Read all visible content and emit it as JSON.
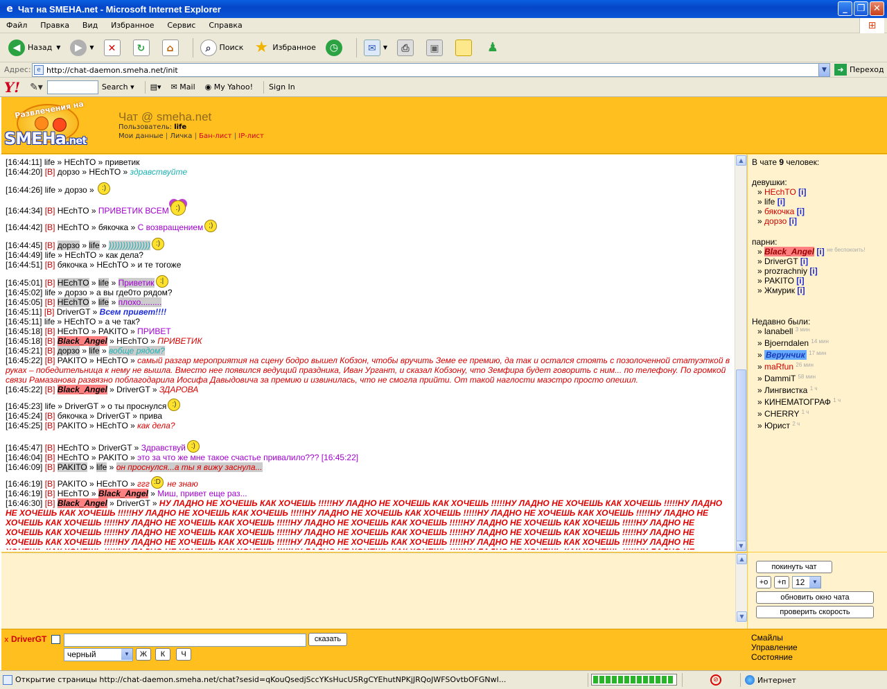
{
  "window": {
    "title": "Чат на SMEHA.net - Microsoft Internet Explorer"
  },
  "menu": [
    "Файл",
    "Правка",
    "Вид",
    "Избранное",
    "Сервис",
    "Справка"
  ],
  "toolbar": {
    "back": "Назад",
    "search": "Поиск",
    "favorites": "Избранное"
  },
  "address": {
    "label": "Адрес:",
    "url": "http://chat-daemon.smeha.net/init",
    "go": "Переход"
  },
  "yahoo": {
    "search": "Search",
    "mail": "Mail",
    "my_yahoo": "My Yahoo!",
    "sign_in": "Sign In"
  },
  "header": {
    "logo_arc": "Развлечения на",
    "logo_text": "SMEHa",
    "logo_net": ".net",
    "site_title": "Чат @ smeha.net",
    "user_label": "Пользователь:",
    "user_name": "life",
    "links": [
      "Мои данные",
      "Личка",
      "Бан-лист",
      "IP-лист"
    ]
  },
  "chat": {
    "messages": [
      {
        "ts": "[16:44:11]",
        "from": "life",
        "to": "HEchTO",
        "text": "приветик",
        "style": "plain"
      },
      {
        "ts": "[16:44:20]",
        "priv": "[В]",
        "from": "дорзо",
        "to": "HEchTO",
        "text": "здравствуйте",
        "style": "cyan"
      },
      {
        "ts": "[16:44:26]",
        "from": "life",
        "to": "дорзо",
        "text": "",
        "smiley": ":)"
      },
      {
        "ts": "[16:44:34]",
        "priv": "[В]",
        "from": "HEchTO",
        "text": "ПРИВЕТИК ВСЕМ",
        "style": "violet",
        "smiley": ":)"
      },
      {
        "ts": "[16:44:42]",
        "priv": "[В]",
        "from": "HEchTO",
        "to": "бякочка",
        "text": "С возвращением",
        "style": "violet",
        "smiley": ";)"
      },
      {
        "ts": "[16:44:45]",
        "priv": "[В]",
        "from": "дорзо",
        "to": "life",
        "text": ")))))))))))))))",
        "style": "cyan",
        "smiley": ":)"
      },
      {
        "ts": "[16:44:49]",
        "from": "life",
        "to": "HEchTO",
        "text": "как дела?",
        "style": "plain"
      },
      {
        "ts": "[16:44:51]",
        "priv": "[В]",
        "from": "бякочка",
        "to": "HEchTO",
        "text": "и те тогоже",
        "style": "plain"
      },
      {
        "ts": "[16:45:01]",
        "priv": "[В]",
        "from": "HEchTO",
        "to": "life",
        "text": "Приветик",
        "style": "violet",
        "smiley": ":|"
      },
      {
        "ts": "[16:45:02]",
        "from": "life",
        "to": "дорзо",
        "text": "а вы где0то рядом?",
        "style": "plain"
      },
      {
        "ts": "[16:45:05]",
        "priv": "[В]",
        "from": "HEchTO",
        "to": "life",
        "text": "плохо.........",
        "style": "violet"
      },
      {
        "ts": "[16:45:11]",
        "priv": "[В]",
        "from": "DriverGT",
        "text": "Всем привет!!!!",
        "style": "blue"
      },
      {
        "ts": "[16:45:11]",
        "from": "life",
        "to": "HEchTO",
        "text": "а че так?",
        "style": "plain"
      },
      {
        "ts": "[16:45:18]",
        "priv": "[В]",
        "from": "HEchTO",
        "to": "PAKITO",
        "text": "ПРИВЕТ",
        "style": "violet"
      },
      {
        "ts": "[16:45:18]",
        "priv": "[В]",
        "from": "Black_Angel",
        "to": "HEchTO",
        "text": "ПРИВЕТИК",
        "style": "red"
      },
      {
        "ts": "[16:45:21]",
        "priv": "[В]",
        "from": "дорзо",
        "to": "life",
        "text": "вобще рядом?",
        "style": "cyan"
      },
      {
        "ts": "[16:45:22]",
        "priv": "[В]",
        "from": "PAKITO",
        "to": "HEchTO",
        "text": "самый разгар мероприятия на сцену бодро вышел Кобзон, чтобы вручить Земе ее премию, да так и остался стоять с позолоченной статуэткой в руках – победительница к нему не вышла. Вместо нее появился ведущий праздника, Иван Ургант, и сказал Кобзону, что Земфира будет говорить с ним... по телефону. По громкой связи Рамазанова развязно поблагодарила Иосифа Давыдовича за премию и извинилась, что не смогла прийти. От такой наглости маэстро просто опешил.",
        "style": "red"
      },
      {
        "ts": "[16:45:22]",
        "priv": "[В]",
        "from": "Black_Angel",
        "to": "DriverGT",
        "text": "ЗДАРОВА",
        "style": "red"
      },
      {
        "ts": "[16:45:23]",
        "from": "life",
        "to": "DriverGT",
        "text": "о ты проснулся",
        "style": "plain",
        "smiley": ":)"
      },
      {
        "ts": "[16:45:24]",
        "priv": "[В]",
        "from": "бякочка",
        "to": "DriverGT",
        "text": "прива",
        "style": "plain"
      },
      {
        "ts": "[16:45:25]",
        "priv": "[В]",
        "from": "PAKITO",
        "to": "HEchTO",
        "text": "как дела?",
        "style": "red"
      },
      {
        "ts": "[16:45:47]",
        "priv": "[В]",
        "from": "HEchTO",
        "to": "DriverGT",
        "text": "Здравствуй",
        "style": "violet",
        "smiley": ":)"
      },
      {
        "ts": "[16:46:04]",
        "priv": "[В]",
        "from": "HEchTO",
        "to": "PAKITO",
        "text": "это за что же мне такое счастье привалило??? [16:45:22]",
        "style": "violet"
      },
      {
        "ts": "[16:46:09]",
        "priv": "[В]",
        "from": "PAKITO",
        "to": "life",
        "text": "он проснулся...а ты я вижу заснула...",
        "style": "red"
      },
      {
        "ts": "[16:46:19]",
        "priv": "[В]",
        "from": "PAKITO",
        "to": "HEchTO",
        "text": "ггг",
        "text2": "не знаю",
        "style": "red",
        "smiley": ":D"
      },
      {
        "ts": "[16:46:19]",
        "priv": "[В]",
        "from": "HEchTO",
        "to": "Black_Angel",
        "text": "Миш, привет еще раз...",
        "style": "violet"
      },
      {
        "ts": "[16:46:30]",
        "priv": "[В]",
        "from": "Black_Angel",
        "to": "DriverGT",
        "text": "НУ ЛАДНО НЕ ХОЧЕШЬ КАК ХОЧЕШЬ !!!!!НУ ЛАДНО НЕ ХОЧЕШЬ КАК ХОЧЕШЬ !!!!!НУ ЛАДНО НЕ ХОЧЕШЬ КАК ХОЧЕШЬ !!!!!НУ ЛАДНО НЕ ХОЧЕШЬ КАК ХОЧЕШЬ !!!!!НУ ЛАДНО НЕ ХОЧЕШЬ КАК ХОЧЕШЬ !!!!!НУ ЛАДНО НЕ ХОЧЕШЬ КАК ХОЧЕШЬ !!!!!НУ ЛАДНО НЕ ХОЧЕШЬ КАК ХОЧЕШЬ !!!!!НУ ЛАДНО НЕ ХОЧЕШЬ КАК ХОЧЕШЬ !!!!!НУ ЛАДНО НЕ ХОЧЕШЬ КАК ХОЧЕШЬ !!!!!НУ ЛАДНО НЕ ХОЧЕШЬ КАК ХОЧЕШЬ !!!!!НУ ЛАДНО НЕ ХОЧЕШЬ КАК ХОЧЕШЬ !!!!!НУ ЛАДНО НЕ ХОЧЕШЬ КАК ХОЧЕШЬ !!!!!НУ ЛАДНО НЕ ХОЧЕШЬ КАК ХОЧЕШЬ !!!!!НУ ЛАДНО НЕ ХОЧЕШЬ КАК ХОЧЕШЬ !!!!!НУ ЛАДНО НЕ ХОЧЕШЬ КАК ХОЧЕШЬ !!!!!НУ ЛАДНО НЕ ХОЧЕШЬ КАК ХОЧЕШЬ !!!!!НУ ЛАДНО НЕ ХОЧЕШЬ КАК ХОЧЕШЬ !!!!!НУ ЛАДНО НЕ ХОЧЕШЬ КАК ХОЧЕШЬ !!!!!НУ ЛАДНО НЕ ХОЧЕШЬ КАК ХОЧЕШЬ !!!!!НУ ЛАДНО НЕ ХОЧЕШЬ КАК ХОЧЕШЬ !!!!!НУ ЛАДНО НЕ ХОЧЕШЬ КАК ХОЧЕШЬ !!!!!НУ ЛАДНО НЕ ХОЧЕШЬ КАК ХОЧЕШЬ !!!!!НУ ЛАДНО НЕ ХОЧЕШЬ КАК ХОЧЕШЬ !!!!!НУ ЛАДНО НЕ ХОЧЕШЬ КАК ХОЧЕШЬ !!!!!НУ ЛАДНО НЕ ХОЧЕШЬ КАК ХОЧЕШЬ !!!!!НУ ЛАДНО НЕ ХОЧЕШЬ КАК ХОЧЕШЬ !!!!!НУ ЛАДНО НЕ ХОЧЕШЬ КАК ХОЧЕШЬ !!!!!НУ ЛАДНО",
        "style": "red-b"
      }
    ]
  },
  "users": {
    "count_prefix": "В чате",
    "count": "9",
    "count_suffix": "человек:",
    "girls_label": "девушки:",
    "girls": [
      "HEchTO",
      "life",
      "бякочка",
      "дорзо"
    ],
    "boys_label": "парни:",
    "boys": [
      "Black_Angel",
      "DriverGT",
      "prozrachniy",
      "PAKITO",
      "Жмурик"
    ],
    "dnd_note": "не беспокоить!",
    "info": "[i]",
    "recent_label": "Недавно были:",
    "recent": [
      {
        "name": "lanabell",
        "ago": "3 мин"
      },
      {
        "name": "Bjoerndalen",
        "ago": "14 мин"
      },
      {
        "name": "Верунчик",
        "ago": "17 мин"
      },
      {
        "name": "maRfun",
        "ago": "26 мин"
      },
      {
        "name": "DammiT",
        "ago": "58 мин"
      },
      {
        "name": "Лингвистка",
        "ago": "1 ч"
      },
      {
        "name": "КИНЕМАТОГРАФ",
        "ago": "1 ч"
      },
      {
        "name": "CHERRY",
        "ago": "1 ч"
      },
      {
        "name": "Юрист",
        "ago": "2 ч"
      }
    ]
  },
  "controls": {
    "leave": "покинуть чат",
    "plus_o": "+о",
    "plus_p": "+п",
    "font_size": "12",
    "refresh": "обновить окно чата",
    "speed": "проверить скорость"
  },
  "composer": {
    "to_x": "x",
    "to_nick": "DriverGT",
    "say": "сказать",
    "color": "черный",
    "bold": "Ж",
    "italic": "К",
    "underline": "Ч"
  },
  "bottom_links": [
    "Смайлы",
    "Управление",
    "Состояние"
  ],
  "status": {
    "text": "Открытие страницы http://chat-daemon.smeha.net/chat?sesid=qKouQsedjSccYKsHucUSRgCYEhutNPKjJRQoJWFSOvtbOFGNwI...",
    "zone": "Интернет"
  }
}
